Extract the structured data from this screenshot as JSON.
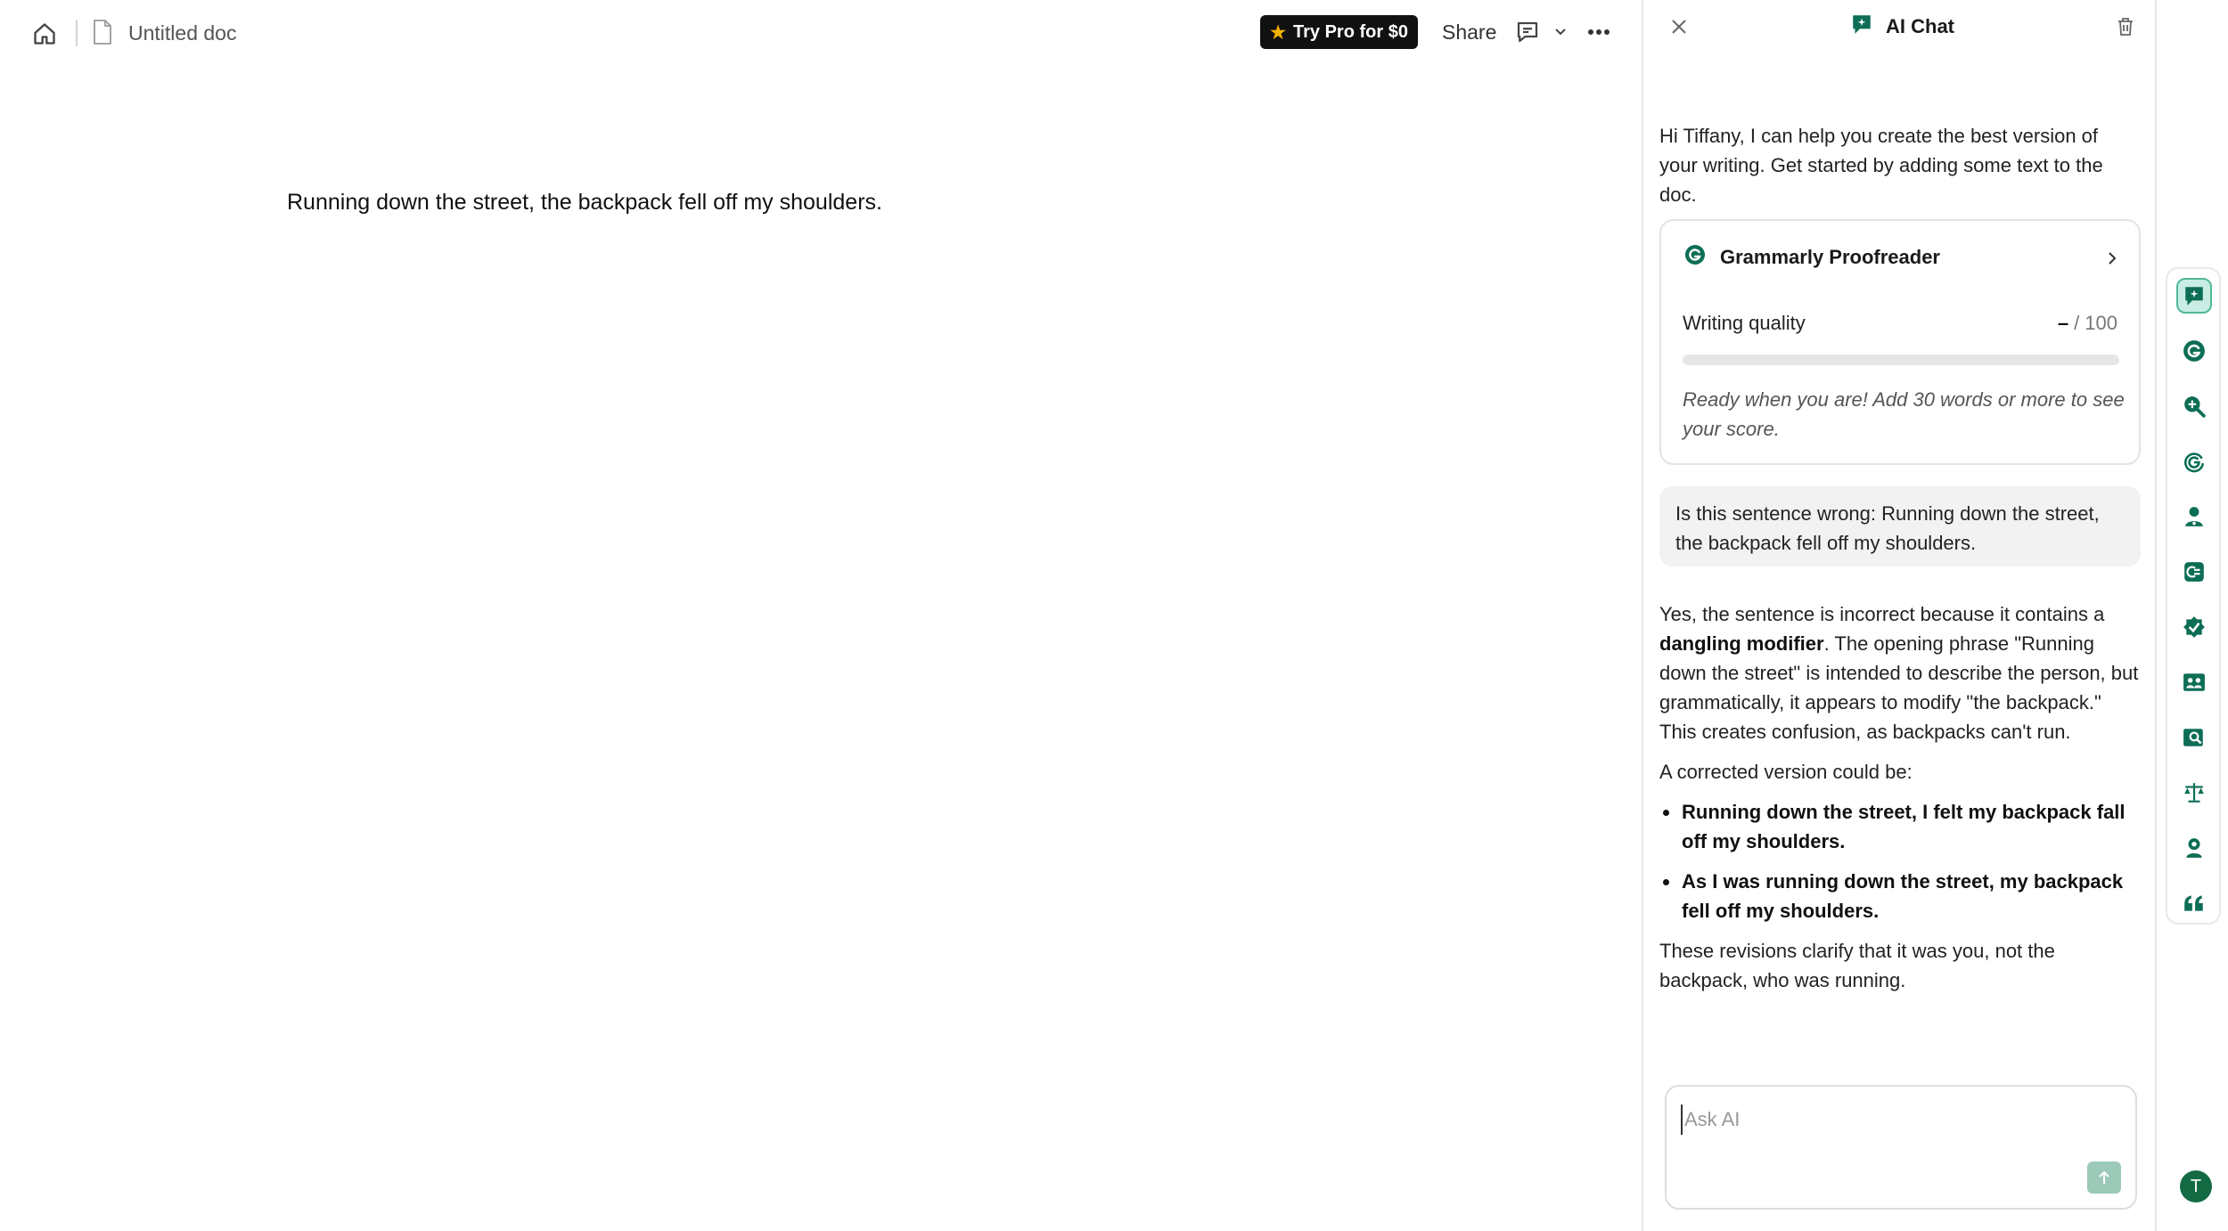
{
  "topbar": {
    "doc_title": "Untitled doc",
    "try_pro_label": "Try Pro for $0",
    "share_label": "Share"
  },
  "document": {
    "text": "Running down the street, the backpack fell off my shoulders."
  },
  "panel": {
    "title": "AI Chat",
    "greeting": "Hi Tiffany, I can help you create the best version of your writing. Get started by adding some text to the doc.",
    "proofreader": {
      "title": "Grammarly Proofreader",
      "quality_label": "Writing quality",
      "score_value": "–",
      "score_max": "/ 100",
      "score_fraction": 0,
      "hint": "Ready when you are! Add 30 words or more to see your score."
    },
    "user_message": "Is this sentence wrong: Running down the street, the backpack fell off my shoulders.",
    "answer": {
      "p1_before": "Yes, the sentence is incorrect because it contains a ",
      "p1_bold": "dangling modifier",
      "p1_after": ". The opening phrase \"Running down the street\" is intended to describe the person, but grammatically, it appears to modify \"the backpack.\" This creates confusion, as backpacks can't run.",
      "p2": "A corrected version could be:",
      "bullets": [
        "Running down the street, I felt my backpack fall off my shoulders.",
        "As I was running down the street, my backpack fell off my shoulders."
      ],
      "p3": "These revisions clarify that it was you, not the backpack, who was running."
    },
    "ask": {
      "placeholder": "Ask AI"
    }
  },
  "rail": {
    "items": [
      "ai-chat-icon",
      "grammarly-icon",
      "search-plagiarism-icon",
      "ai-detector-icon",
      "reader-reactions-icon",
      "paraphraser-icon",
      "proofreader-check-icon",
      "audience-icon",
      "citation-finder-icon",
      "legal-scale-icon",
      "expert-review-icon",
      "quote-icon"
    ],
    "avatar_letter": "T"
  },
  "colors": {
    "accent": "#0d6e55",
    "rail_active_bg": "#c9ede3",
    "send_button": "#9cc9b8",
    "avatar": "#146b43"
  }
}
